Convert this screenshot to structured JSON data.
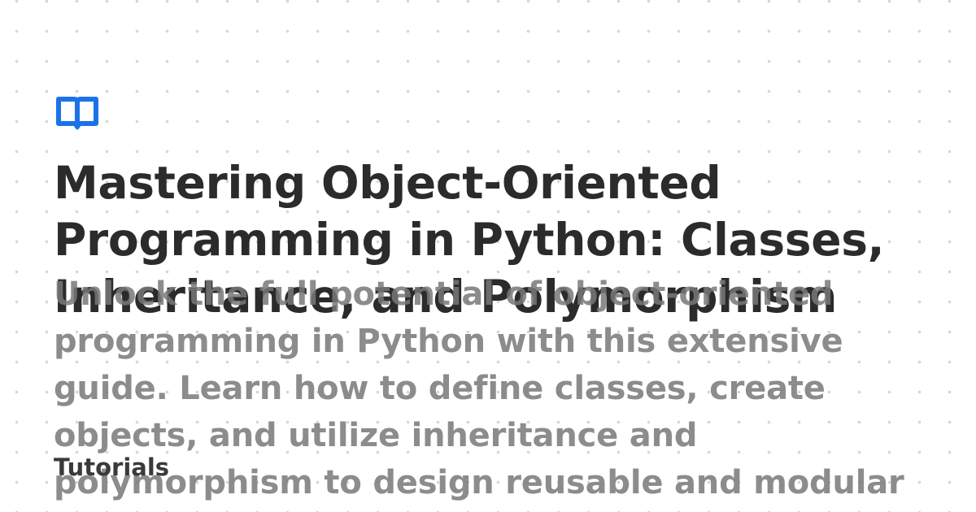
{
  "post": {
    "title": "Mastering Object-Oriented Programming in Python: Classes, Inheritance, and Polymorphism",
    "description": "Unlock the full potential of object-oriented programming in Python with this extensive guide. Learn how to define classes, create objects, and utilize inheritance and polymorphism to design reusable and modular",
    "category": "Tutorials"
  },
  "logo": {
    "icon": "open-book-icon",
    "color": "#1a73e8"
  },
  "colors": {
    "title": "#2b2b2b",
    "description": "#7a7a7a",
    "background": "#ffffff",
    "dots": "#d6d6d6"
  }
}
